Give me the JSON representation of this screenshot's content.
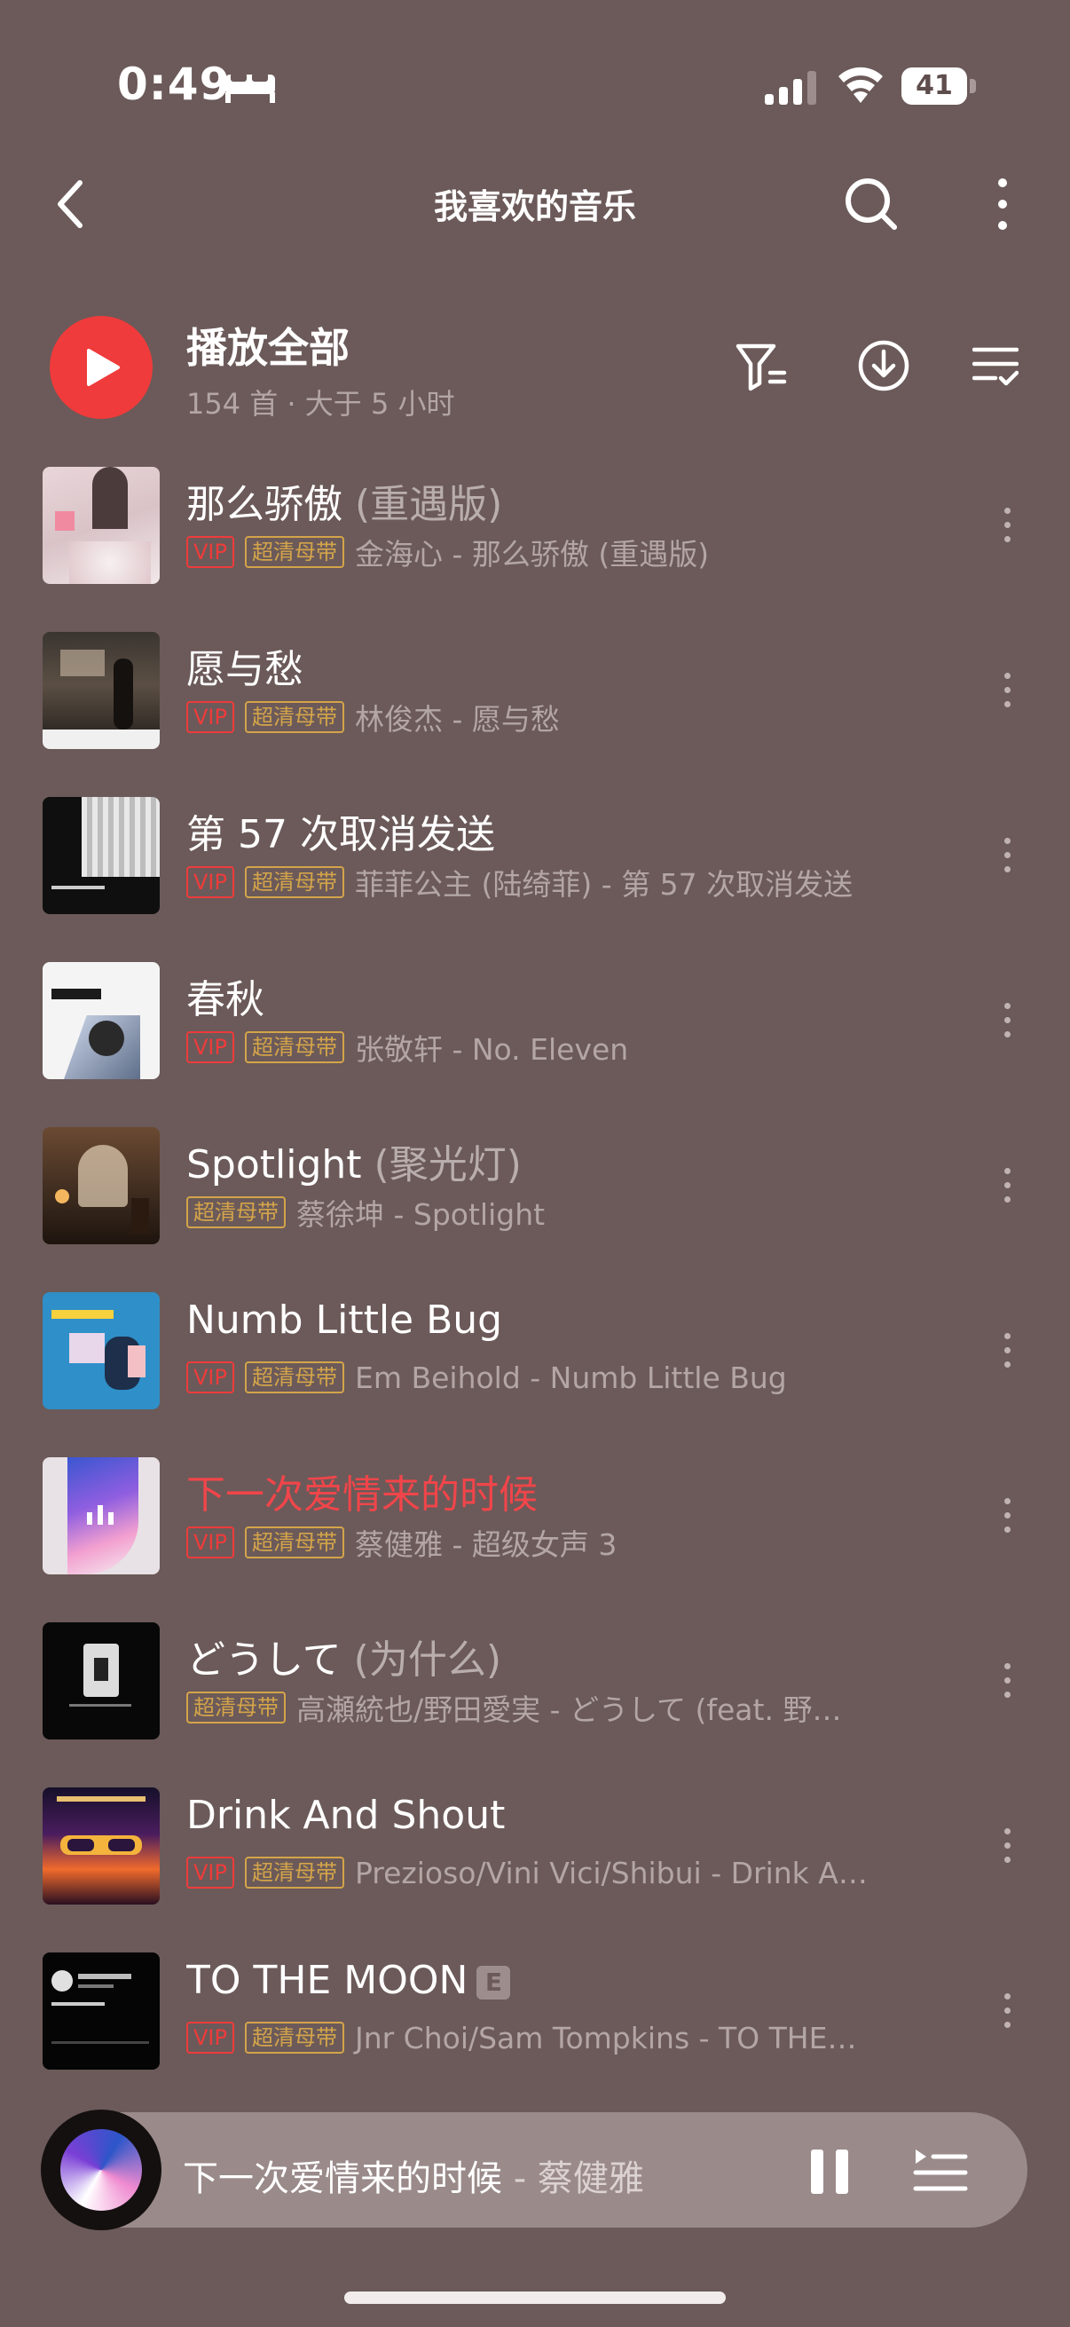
{
  "status": {
    "time": "0:49",
    "battery": "41"
  },
  "nav": {
    "title": "我喜欢的音乐"
  },
  "play_all": {
    "label": "播放全部",
    "meta": "154 首 · 大于 5 小时"
  },
  "badges": {
    "vip": "VIP",
    "hq": "超清母带",
    "explicit": "E"
  },
  "songs": [
    {
      "title": "那么骄傲",
      "alt": " (重遇版)",
      "vip": true,
      "hq": true,
      "subtitle": "金海心 - 那么骄傲 (重遇版)",
      "playing": false
    },
    {
      "title": "愿与愁",
      "alt": "",
      "vip": true,
      "hq": true,
      "subtitle": "林俊杰 - 愿与愁",
      "playing": false
    },
    {
      "title": "第 57 次取消发送",
      "alt": "",
      "vip": true,
      "hq": true,
      "subtitle": "菲菲公主 (陆绮菲) - 第 57 次取消发送",
      "playing": false
    },
    {
      "title": "春秋",
      "alt": "",
      "vip": true,
      "hq": true,
      "subtitle": "张敬轩 - No. Eleven",
      "playing": false
    },
    {
      "title": "Spotlight",
      "alt": " (聚光灯)",
      "vip": false,
      "hq": true,
      "subtitle": "蔡徐坤 - Spotlight",
      "playing": false
    },
    {
      "title": "Numb Little Bug",
      "alt": "",
      "vip": true,
      "hq": true,
      "subtitle": "Em Beihold - Numb Little Bug",
      "playing": false
    },
    {
      "title": "下一次爱情来的时候",
      "alt": "",
      "vip": true,
      "hq": true,
      "subtitle": "蔡健雅 - 超级女声 3",
      "playing": true
    },
    {
      "title": "どうして",
      "alt": " (为什么)",
      "vip": false,
      "hq": true,
      "subtitle": "高瀬統也/野田愛実 - どうして (feat. 野…",
      "playing": false
    },
    {
      "title": "Drink And Shout",
      "alt": "",
      "vip": true,
      "hq": true,
      "subtitle": "Prezioso/Vini Vici/Shibui - Drink A…",
      "playing": false
    },
    {
      "title": "TO THE MOON",
      "alt": "",
      "vip": true,
      "hq": true,
      "explicit": true,
      "subtitle": "Jnr Choi/Sam Tompkins - TO THE…",
      "playing": false
    }
  ],
  "mini_player": {
    "title": "下一次爱情来的时候",
    "artist": " - 蔡健雅"
  },
  "colors": {
    "background": "#6b5a59",
    "accent": "#ef3b3b",
    "hq": "#d4a44a",
    "playing_title": "#f0454a"
  }
}
